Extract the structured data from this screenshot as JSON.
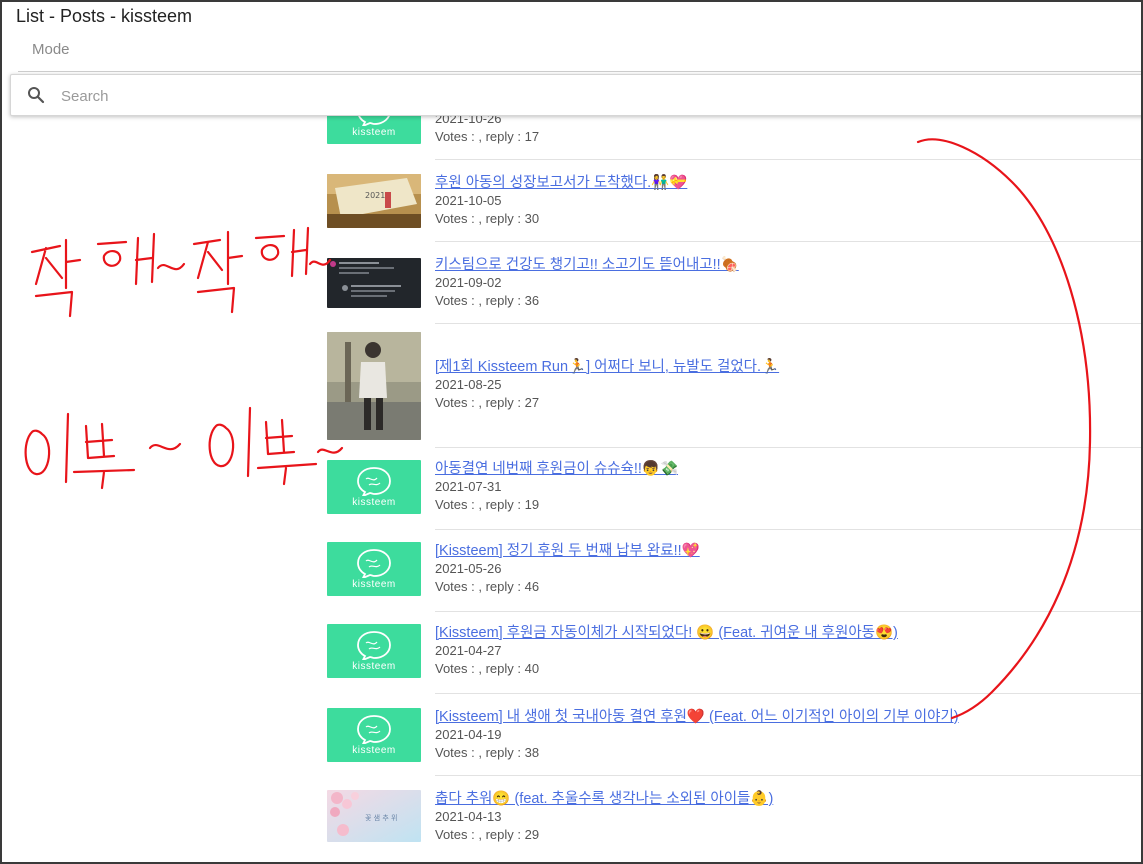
{
  "window": {
    "title": "List - Posts - kissteem"
  },
  "mode": {
    "placeholder": "Mode"
  },
  "search": {
    "placeholder": "Search"
  },
  "posts": [
    {
      "title": "",
      "date": "2021-10-26",
      "stats": "Votes : , reply : 17",
      "thumb": "kissteem"
    },
    {
      "title": "후원 아동의 성장보고서가 도착했다.👫💝",
      "date": "2021-10-05",
      "stats": "Votes : , reply : 30",
      "thumb": "calendar"
    },
    {
      "title": "키스팀으로 건강도 챙기고!! 소고기도 뜯어내고!!🍖",
      "date": "2021-09-02",
      "stats": "Votes : , reply : 36",
      "thumb": "chat-screenshot"
    },
    {
      "title": "[제1회 Kissteem Run🏃] 어쩌다 보니, 뉴발도 걸었다.🏃",
      "date": "2021-08-25",
      "stats": "Votes : , reply : 27",
      "thumb": "person-photo"
    },
    {
      "title": "아동결연 네번째 후원금이 슈슈슉!!👦💸",
      "date": "2021-07-31",
      "stats": "Votes : , reply : 19",
      "thumb": "kissteem"
    },
    {
      "title": "[Kissteem] 정기 후원 두 번째 납부 완료!!💖",
      "date": "2021-05-26",
      "stats": "Votes : , reply : 46",
      "thumb": "kissteem"
    },
    {
      "title": "[Kissteem] 후원금 자동이체가 시작되었다! 😀 (Feat. 귀여운 내 후원아동😍)",
      "date": "2021-04-27",
      "stats": "Votes : , reply : 40",
      "thumb": "kissteem"
    },
    {
      "title": "[Kissteem] 내 생애 첫 국내아동 결연 후원❤️ (Feat. 어느 이기적인 아이의 기부 이야기)",
      "date": "2021-04-19",
      "stats": "Votes : , reply : 38",
      "thumb": "kissteem"
    },
    {
      "title": "춥다 추워😁 (feat. 추울수록 생각나는 소외된 아이들👶)",
      "date": "2021-04-13",
      "stats": "Votes : , reply : 29",
      "thumb": "cherry-blossom"
    }
  ],
  "thumb_brand_text": "kissteem",
  "blossom_text": "꽃 샘 추 위",
  "annotations": {
    "handwriting_top": "착해~착해~",
    "handwriting_bottom": "이뻐~이뻐~",
    "ink_color": "#e8141a"
  },
  "colors": {
    "link": "#4a6ee0",
    "brand": "#3ddc9d"
  }
}
